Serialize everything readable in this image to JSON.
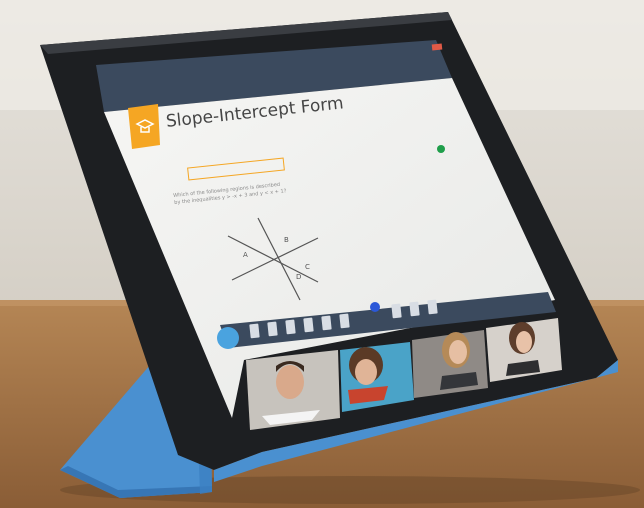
{
  "lesson": {
    "title": "Slope-Intercept Form",
    "logo_icon": "graduation-cap-icon",
    "prompt_line1": "Which of the following regions is described",
    "prompt_line2": "by the inequalities y > -x + 3 and y < x + 1?",
    "graph_labels": [
      "A",
      "B",
      "C",
      "D"
    ]
  },
  "toolbar": {
    "tools": [
      "pen-icon",
      "highlighter-icon",
      "eraser-icon",
      "line-icon",
      "shape-icon",
      "text-icon",
      "color-icon",
      "undo-icon",
      "redo-icon",
      "clear-icon"
    ]
  },
  "colors": {
    "accent_orange": "#f5a623",
    "toolbar_blue": "#3b4a5e",
    "tool_active": "#4aa3df",
    "marker_green": "#1f9e4a",
    "case_blue": "#4a90d0",
    "table": "#b07a4a"
  }
}
